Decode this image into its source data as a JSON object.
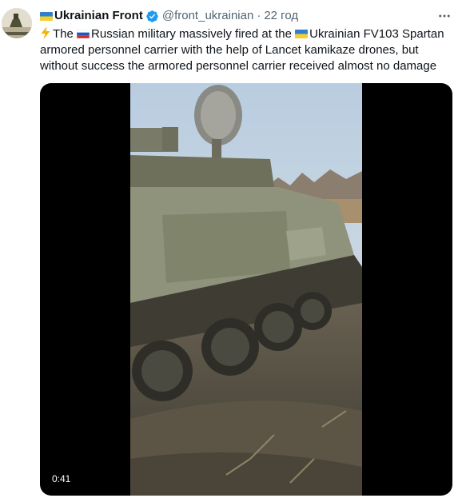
{
  "account": {
    "display_name": "Ukrainian Front",
    "handle": "@front_ukrainian",
    "separator": "·",
    "time_ago": "22 год"
  },
  "tweet": {
    "part1": "The ",
    "part2": "Russian military massively fired at the ",
    "part3": "Ukrainian FV103 Spartan armored personnel carrier with the help of Lancet kamikaze drones, but without success the armored personnel carrier received almost no damage"
  },
  "media": {
    "duration": "0:41"
  },
  "icons": {
    "more": "more-horizontal-icon",
    "verified": "verified-badge-icon",
    "bolt": "high-voltage-emoji"
  },
  "colors": {
    "verified_blue": "#1d9bf0",
    "secondary_text": "#536471",
    "primary_text": "#0f1419"
  }
}
